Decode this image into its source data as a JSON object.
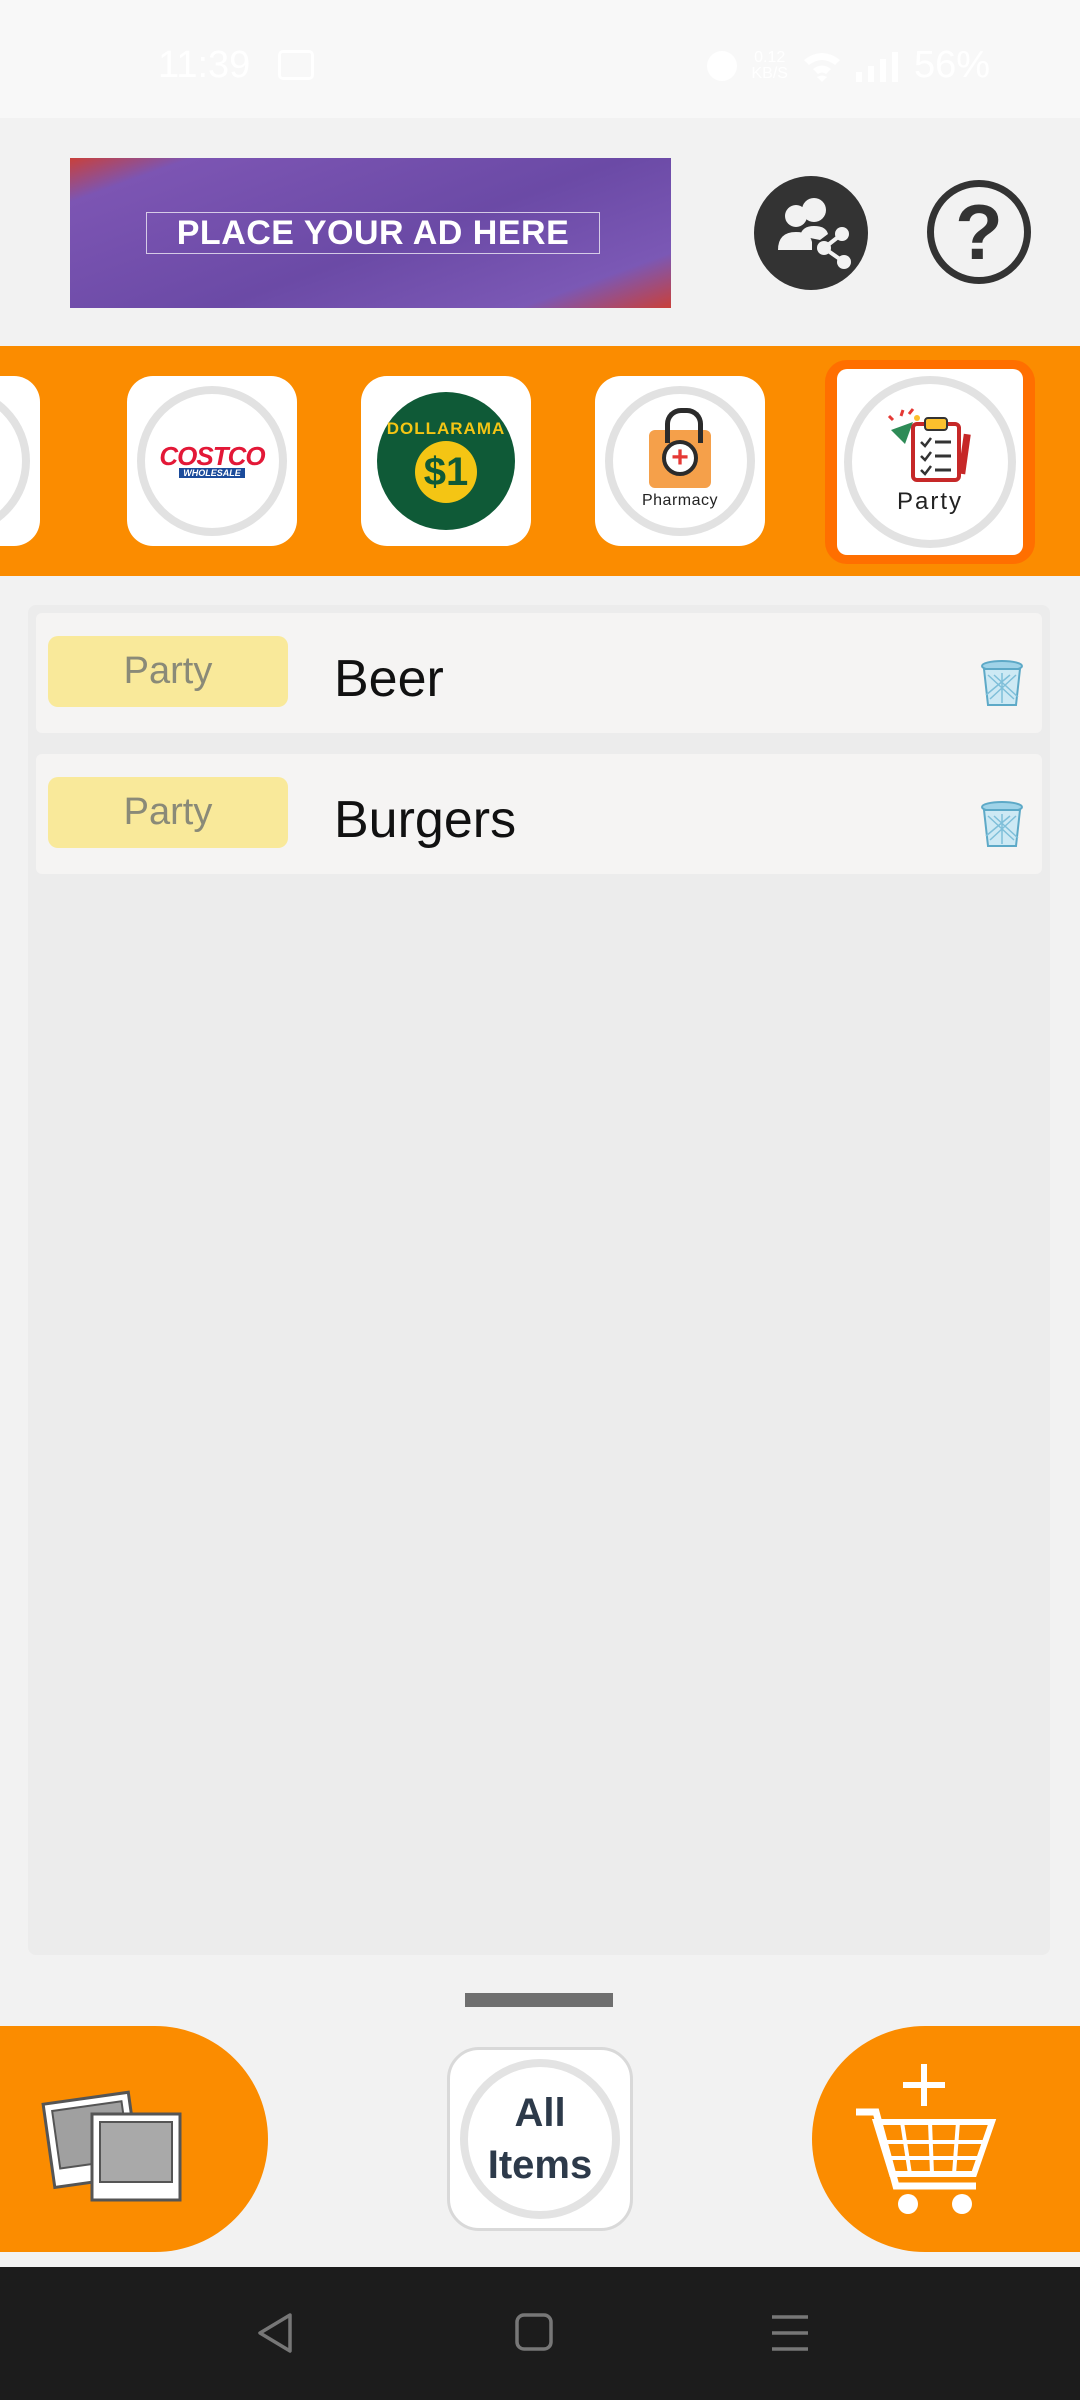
{
  "status_bar": {
    "time": "11:39",
    "network_speed_top": "0.12",
    "network_speed_unit": "KB/S",
    "battery": "56%"
  },
  "header": {
    "ad_text": "PLACE YOUR AD HERE",
    "share_icon": "share-users-icon",
    "help_icon": "question-icon",
    "help_glyph": "?"
  },
  "stores": [
    {
      "name": "costco",
      "logo_text": "COSTCO",
      "logo_sub": "WHOLESALE"
    },
    {
      "name": "dollarama",
      "logo_text": "DOLLARAMA",
      "logo_sub": "$1"
    },
    {
      "name": "pharmacy",
      "label": "Pharmacy"
    },
    {
      "name": "party",
      "label": "Party",
      "selected": true
    }
  ],
  "items": [
    {
      "category": "Party",
      "name": "Beer"
    },
    {
      "category": "Party",
      "name": "Burgers"
    }
  ],
  "bottom": {
    "all_items_line1": "All",
    "all_items_line2": "Items"
  },
  "colors": {
    "accent": "#fb8c00",
    "selected_border": "#ff6f00",
    "badge": "#f9e99a",
    "background": "#f2f2f2"
  }
}
